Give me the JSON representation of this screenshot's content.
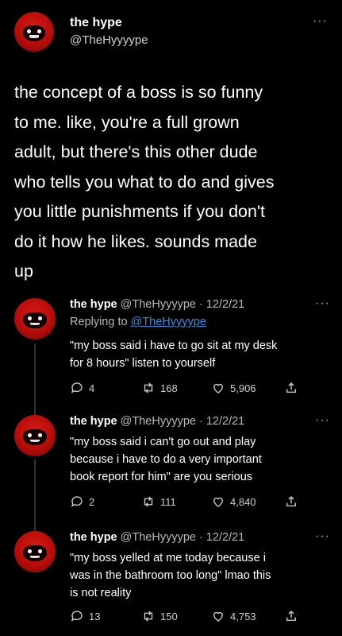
{
  "header": {
    "name": "the hype",
    "handle": "@TheHyyyype",
    "more": "···"
  },
  "main_tweet": {
    "lines": [
      "the concept of a boss is so funny",
      "to me. like, you're a full grown",
      "adult, but there's this other dude",
      "who tells you what to do and gives",
      "you little punishments if you don't",
      "do it how he likes. sounds made",
      "up"
    ]
  },
  "replies": [
    {
      "name": "the hype",
      "handle_date": "@TheHyyyype · 12/2/21",
      "replying_prefix": "Replying to ",
      "replying_handle": "@TheHyyyype",
      "text_lines": [
        "\"my boss said i have to go sit at my desk",
        "for 8 hours\" listen to yourself"
      ],
      "replies": "4",
      "retweets": "168",
      "likes": "5,906"
    },
    {
      "name": "the hype",
      "handle_date": "@TheHyyyype · 12/2/21",
      "text_lines": [
        "\"my boss said i can't go out and play",
        "because i have to do a very important",
        "book report for him\" are you serious"
      ],
      "replies": "2",
      "retweets": "111",
      "likes": "4,840"
    },
    {
      "name": "the hype",
      "handle_date": "@TheHyyyype · 12/2/21",
      "text_lines": [
        "\"my boss yelled at me today because i",
        "was in the bathroom too long\" lmao this",
        "is not reality"
      ],
      "replies": "13",
      "retweets": "150",
      "likes": "4,753"
    }
  ]
}
